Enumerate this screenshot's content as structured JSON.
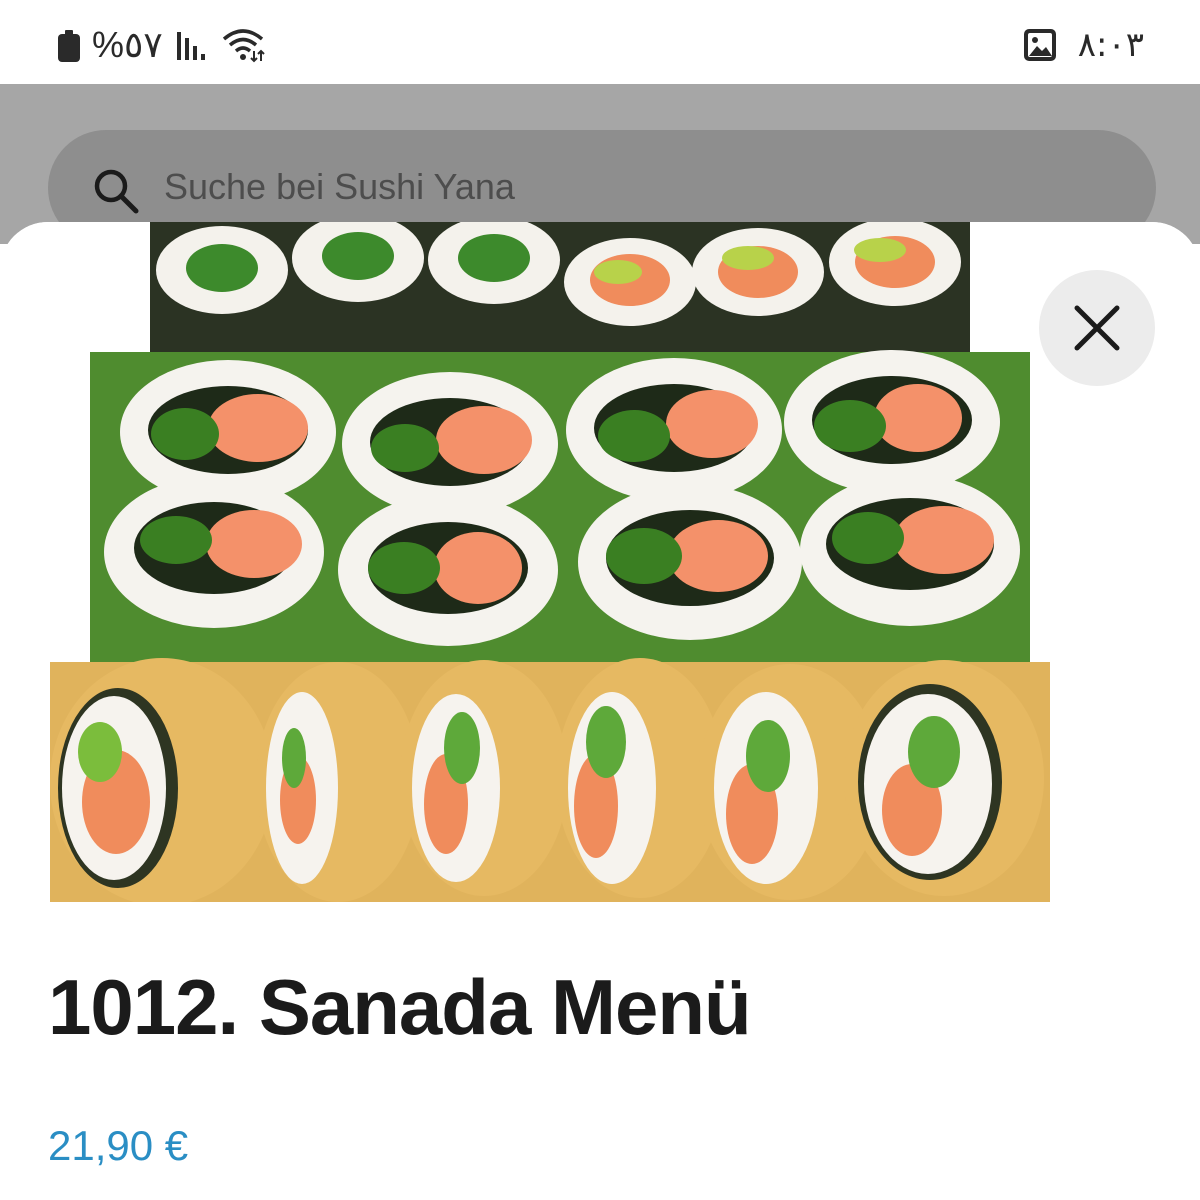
{
  "status_bar": {
    "battery_text": "%٥٧",
    "time": "٨:٠٣",
    "icons": [
      "battery-icon",
      "signal-icon",
      "wifi-icon",
      "gallery-icon"
    ]
  },
  "search": {
    "placeholder": "Suche bei Sushi Yana"
  },
  "product": {
    "title": "1012. Sanada Menü",
    "price": "21,90 €",
    "image": "sushi-rolls-photo"
  },
  "colors": {
    "price": "#2a8ec4",
    "title": "#1b1b1b",
    "dim_overlay": "#a6a6a6",
    "close_button_bg": "#ececec"
  }
}
